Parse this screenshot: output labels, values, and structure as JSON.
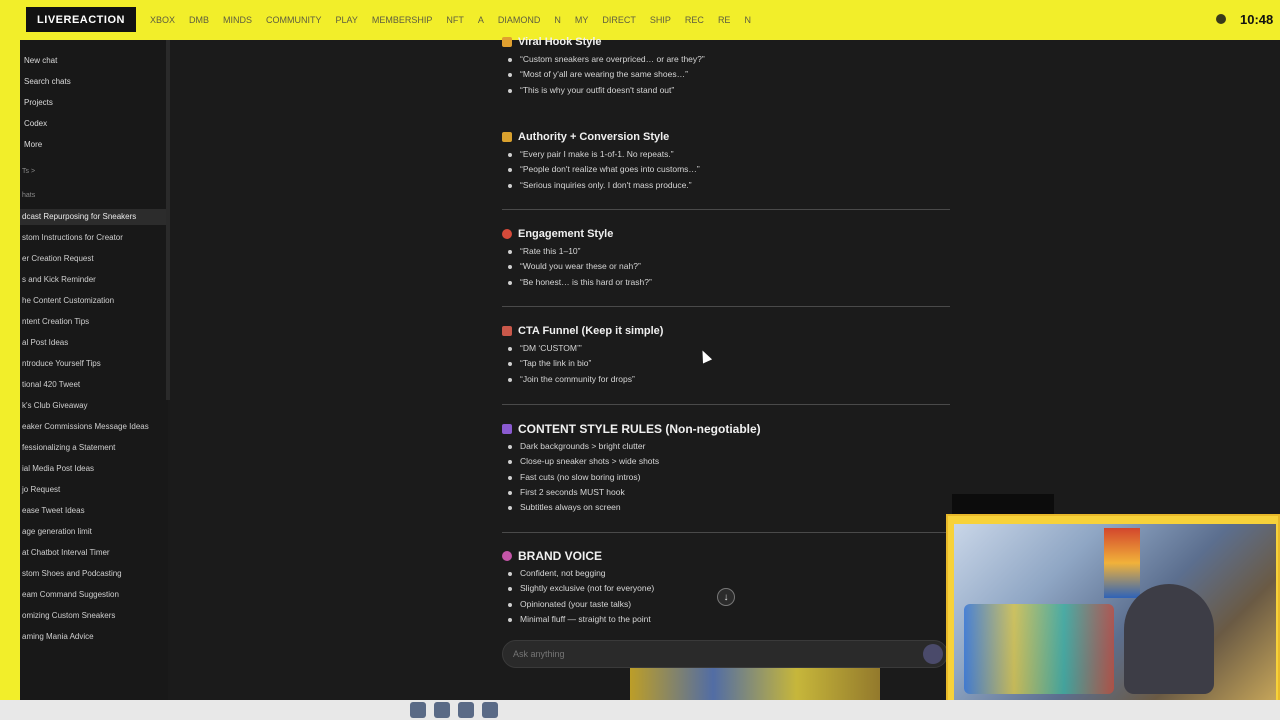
{
  "stream_overlay": {
    "brand": "LIVEREACTION",
    "clock": "10:48",
    "ticker_items": [
      "XBOX",
      "DMB",
      "MINDS",
      "COMMUNITY",
      "PLAY",
      "MEMBERSHIP",
      "NFT",
      "A",
      "DIAMOND",
      "N",
      "MY",
      "DIRECT",
      "SHIP",
      "REC",
      "RE",
      "N"
    ]
  },
  "sidebar": {
    "items": [
      {
        "label": "New chat"
      },
      {
        "label": "Search chats"
      },
      {
        "label": "Projects"
      },
      {
        "label": "Codex"
      },
      {
        "label": "More"
      }
    ],
    "section_gpts": "Ts >",
    "section_chats": "hats",
    "chats": [
      {
        "label": "dcast Repurposing for Sneakers",
        "active": true
      },
      {
        "label": "stom Instructions for Creator"
      },
      {
        "label": "er Creation Request"
      },
      {
        "label": "s and Kick Reminder"
      },
      {
        "label": "he Content Customization"
      },
      {
        "label": "ntent Creation Tips"
      },
      {
        "label": "al Post Ideas"
      },
      {
        "label": "ntroduce Yourself Tips"
      },
      {
        "label": "tional 420 Tweet"
      },
      {
        "label": "k's Club Giveaway"
      },
      {
        "label": "eaker Commissions Message Ideas"
      },
      {
        "label": "fessionalizing a Statement"
      },
      {
        "label": "ial Media Post Ideas"
      },
      {
        "label": "jo Request"
      },
      {
        "label": "ease Tweet Ideas"
      },
      {
        "label": "age generation limit"
      },
      {
        "label": "at Chatbot Interval Timer"
      },
      {
        "label": "stom Shoes and Podcasting"
      },
      {
        "label": "eam Command Suggestion"
      },
      {
        "label": "omizing Custom Sneakers"
      },
      {
        "label": "aming Mania Advice"
      }
    ]
  },
  "content": {
    "sections": [
      {
        "title": "Viral Hook Style",
        "items": [
          "“Custom sneakers are overpriced… or are they?”",
          "“Most of y'all are wearing the same shoes…”",
          "“This is why your outfit doesn't stand out”"
        ]
      },
      {
        "title": "Authority + Conversion Style",
        "items": [
          "“Every pair I make is 1-of-1. No repeats.”",
          "“People don't realize what goes into customs…”",
          "“Serious inquiries only. I don't mass produce.”"
        ]
      },
      {
        "title": "Engagement Style",
        "items": [
          "“Rate this 1–10”",
          "“Would you wear these or nah?”",
          "“Be honest… is this hard or trash?”"
        ]
      },
      {
        "title": "CTA Funnel (Keep it simple)",
        "items": [
          "“DM ‘CUSTOM’”",
          "“Tap the link in bio”",
          "“Join the community for drops”"
        ]
      },
      {
        "title": "CONTENT STYLE RULES (Non-negotiable)",
        "items": [
          "Dark backgrounds > bright clutter",
          "Close-up sneaker shots > wide shots",
          "Fast cuts (no slow boring intros)",
          "First 2 seconds MUST hook",
          "Subtitles always on screen"
        ]
      },
      {
        "title": "BRAND VOICE",
        "items": [
          "Confident, not begging",
          "Slightly exclusive (not for everyone)",
          "Opinionated (your taste talks)",
          "Minimal fluff — straight to the point"
        ]
      }
    ]
  },
  "composer": {
    "placeholder": "Ask anything"
  },
  "colors": {
    "overlay_yellow": "#f2ee2a",
    "background": "#1b1b1b",
    "sidebar": "#181818",
    "text": "#e6e6e6"
  }
}
